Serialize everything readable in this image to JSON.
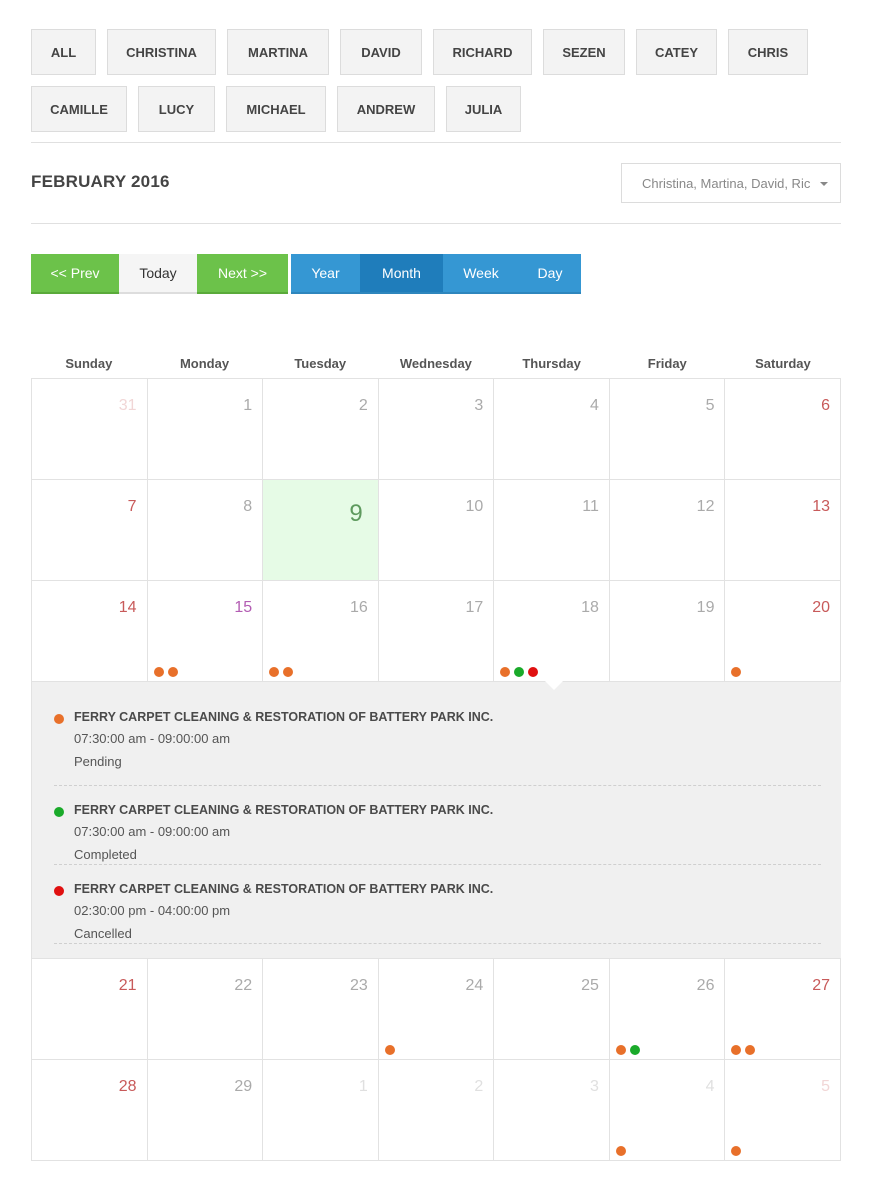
{
  "filters": {
    "row1": [
      "ALL",
      "CHRISTINA",
      "MARTINA",
      "DAVID",
      "RICHARD",
      "SEZEN",
      "CATEY",
      "CHRIS"
    ],
    "row2": [
      "CAMILLE",
      "LUCY",
      "MICHAEL",
      "ANDREW",
      "JULIA"
    ]
  },
  "header": {
    "month_title": "FEBRUARY 2016",
    "staff_select_value": "Christina, Martina, David, Ric"
  },
  "nav": {
    "prev": "<< Prev",
    "today": "Today",
    "next": "Next >>",
    "year": "Year",
    "month": "Month",
    "week": "Week",
    "day": "Day",
    "active_view": "Month"
  },
  "days_of_week": [
    "Sunday",
    "Monday",
    "Tuesday",
    "Wednesday",
    "Thursday",
    "Friday",
    "Saturday"
  ],
  "colors": {
    "pending": "#e8702a",
    "completed": "#1aaa2a",
    "cancelled": "#e01010",
    "today_bg": "#e6fbe6",
    "nav_green": "#6cc24a",
    "nav_blue": "#3597d3"
  },
  "calendar": {
    "weeks": [
      [
        {
          "day": "31",
          "muted": true,
          "dots": []
        },
        {
          "day": "1",
          "dots": []
        },
        {
          "day": "2",
          "dots": []
        },
        {
          "day": "3",
          "dots": []
        },
        {
          "day": "4",
          "dots": []
        },
        {
          "day": "5",
          "dots": []
        },
        {
          "day": "6",
          "dots": []
        }
      ],
      [
        {
          "day": "7",
          "dots": []
        },
        {
          "day": "8",
          "dots": []
        },
        {
          "day": "9",
          "today": true,
          "dots": []
        },
        {
          "day": "10",
          "dots": []
        },
        {
          "day": "11",
          "dots": []
        },
        {
          "day": "12",
          "dots": []
        },
        {
          "day": "13",
          "dots": []
        }
      ],
      [
        {
          "day": "14",
          "dots": []
        },
        {
          "day": "15",
          "holiday": true,
          "dots": [
            "pending",
            "pending"
          ]
        },
        {
          "day": "16",
          "dots": [
            "pending",
            "pending"
          ]
        },
        {
          "day": "17",
          "dots": []
        },
        {
          "day": "18",
          "dots": [
            "pending",
            "completed",
            "cancelled"
          ]
        },
        {
          "day": "19",
          "dots": []
        },
        {
          "day": "20",
          "dots": [
            "pending"
          ]
        }
      ],
      [
        {
          "day": "21",
          "dots": []
        },
        {
          "day": "22",
          "dots": []
        },
        {
          "day": "23",
          "dots": []
        },
        {
          "day": "24",
          "dots": [
            "pending"
          ]
        },
        {
          "day": "25",
          "dots": []
        },
        {
          "day": "26",
          "dots": [
            "pending",
            "completed"
          ]
        },
        {
          "day": "27",
          "dots": [
            "pending",
            "pending"
          ]
        }
      ],
      [
        {
          "day": "28",
          "dots": []
        },
        {
          "day": "29",
          "dots": []
        },
        {
          "day": "1",
          "muted": true,
          "dots": []
        },
        {
          "day": "2",
          "muted": true,
          "dots": []
        },
        {
          "day": "3",
          "muted": true,
          "dots": []
        },
        {
          "day": "4",
          "muted": true,
          "dots": [
            "pending"
          ]
        },
        {
          "day": "5",
          "muted": true,
          "dots": [
            "pending"
          ]
        }
      ]
    ]
  },
  "event_detail": {
    "events": [
      {
        "title": "FERRY CARPET CLEANING & RESTORATION OF BATTERY PARK INC.",
        "time": "07:30:00 am - 09:00:00 am",
        "status": "Pending",
        "status_key": "pending"
      },
      {
        "title": "FERRY CARPET CLEANING & RESTORATION OF BATTERY PARK INC.",
        "time": "07:30:00 am - 09:00:00 am",
        "status": "Completed",
        "status_key": "completed"
      },
      {
        "title": "FERRY CARPET CLEANING & RESTORATION OF BATTERY PARK INC.",
        "time": "02:30:00 pm - 04:00:00 pm",
        "status": "Cancelled",
        "status_key": "cancelled"
      }
    ]
  }
}
